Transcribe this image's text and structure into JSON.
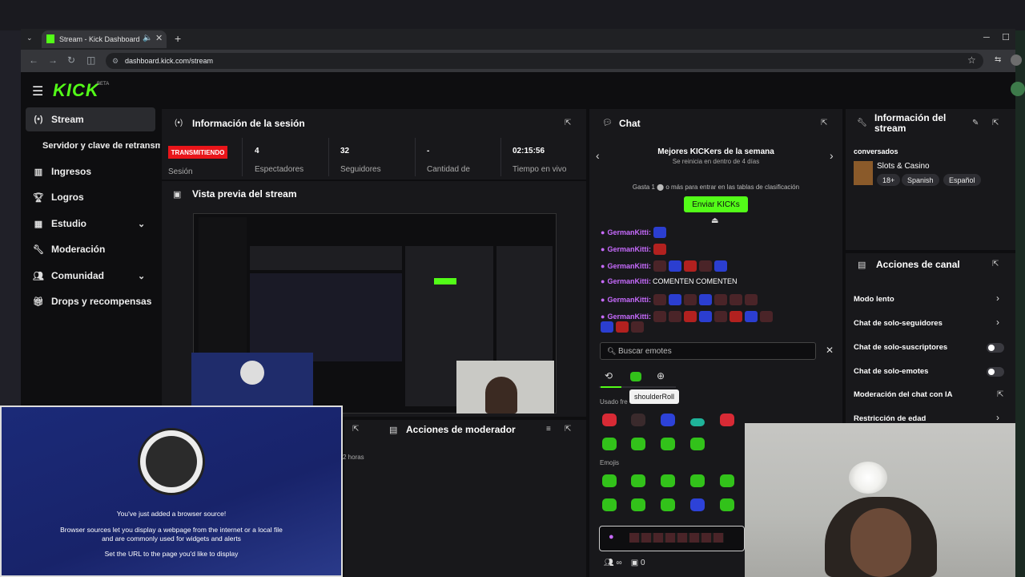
{
  "browser": {
    "tab_title": "Stream - Kick Dashboard",
    "url": "dashboard.kick.com/stream",
    "new_tab": "+",
    "tab_close": "✕"
  },
  "brand": {
    "logo": "KICK",
    "beta": "BETA",
    "accent": "#53fc18",
    "live_red": "#e9151a"
  },
  "sidebar": {
    "items": [
      {
        "label": "Stream",
        "icon": "stream-icon"
      },
      {
        "label": "Servidor y clave de retransmisión"
      },
      {
        "label": "Ingresos",
        "icon": "bar-chart-icon"
      },
      {
        "label": "Logros",
        "icon": "trophy-icon"
      },
      {
        "label": "Estudio",
        "icon": "grid-icon"
      },
      {
        "label": "Moderación",
        "icon": "wrench-icon"
      },
      {
        "label": "Comunidad",
        "icon": "people-icon"
      },
      {
        "label": "Drops y recompensas",
        "icon": "gift-icon"
      }
    ]
  },
  "session": {
    "title": "Información de la sesión",
    "status": "TRANSMITIENDO",
    "status_label": "Sesión",
    "stats": [
      {
        "value": "4",
        "label": "Espectadores"
      },
      {
        "value": "32",
        "label": "Seguidores"
      },
      {
        "value": "-",
        "label": "Cantidad de"
      },
      {
        "value": "02:15:56",
        "label": "Tiempo en vivo"
      }
    ]
  },
  "preview": {
    "title": "Vista previa del stream"
  },
  "mod_actions": {
    "title": "Acciones de moderador",
    "partial": "2 horas"
  },
  "obs": {
    "line1": "You've just added a browser source!",
    "line2": "Browser sources let you display a webpage from the internet or a local file",
    "line3": "and are commonly used for widgets and alerts",
    "line4": "Set the URL to the page you'd like to display"
  },
  "chat": {
    "title": "Chat",
    "leaderboard_title": "Mejores KICKers de la semana",
    "leaderboard_sub": "Se reinicia en dentro de 4 días",
    "spend_text": "Gasta 1 ⬤ o más para entrar en las tablas de clasificación",
    "send_button": "Enviar KICKs",
    "messages": [
      {
        "user": "GermanKitti:",
        "text": ""
      },
      {
        "user": "GermanKitti:",
        "text": ""
      },
      {
        "user": "GermanKitti:",
        "text": ""
      },
      {
        "user": "GermanKitti:",
        "text": "COMENTEN COMENTEN"
      },
      {
        "user": "GermanKitti:",
        "text": ""
      },
      {
        "user": "GermanKitti:",
        "text": ""
      }
    ],
    "search_placeholder": "Buscar emotes",
    "section_recent": "Usado fre",
    "tooltip": "shoulderRoll",
    "section_emojis": "Emojis",
    "bottom_count": "0",
    "infinity": "∞"
  },
  "info": {
    "title": "Información del stream",
    "conversation": "conversados",
    "category": "Slots & Casino",
    "tags": [
      "18+",
      "Spanish",
      "Español"
    ]
  },
  "channel_actions": {
    "title": "Acciones de canal",
    "rows": [
      {
        "label": "Modo lento",
        "control": "chevron"
      },
      {
        "label": "Chat de solo-seguidores",
        "control": "chevron"
      },
      {
        "label": "Chat de solo-suscriptores",
        "control": "toggle",
        "on": false
      },
      {
        "label": "Chat de solo-emotes",
        "control": "toggle",
        "on": false
      },
      {
        "label": "Moderación del chat con IA",
        "control": "external"
      },
      {
        "label": "Restricción de edad",
        "control": "chevron"
      }
    ]
  }
}
